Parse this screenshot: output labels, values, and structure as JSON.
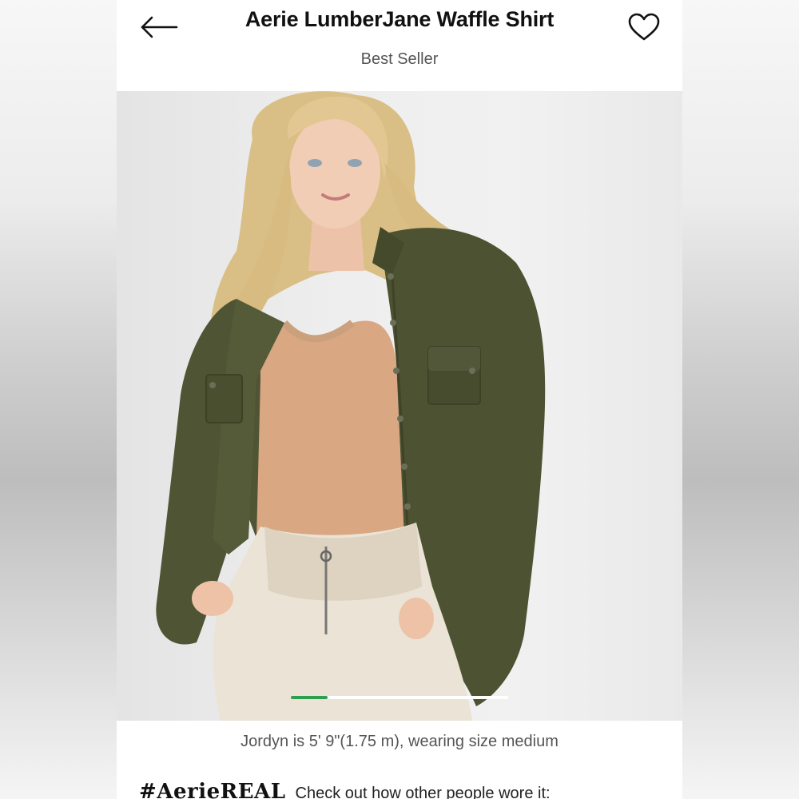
{
  "header": {
    "title": "Aerie LumberJane Waffle Shirt",
    "subtitle": "Best Seller",
    "back_icon": "arrow-left-icon",
    "favorite_icon": "heart-outline-icon"
  },
  "product_image": {
    "alt": "Model wearing olive green waffle-knit button-up shirt over a tan camisole with cream sweatpants",
    "carousel_progress": 0.17,
    "accent_color": "#2e9e4f"
  },
  "caption": "Jordyn is 5' 9\"(1.75 m), wearing size medium",
  "aerie_real": {
    "hashtag": "#AerieREAL",
    "link_text": "Check out how other people wore it:"
  }
}
